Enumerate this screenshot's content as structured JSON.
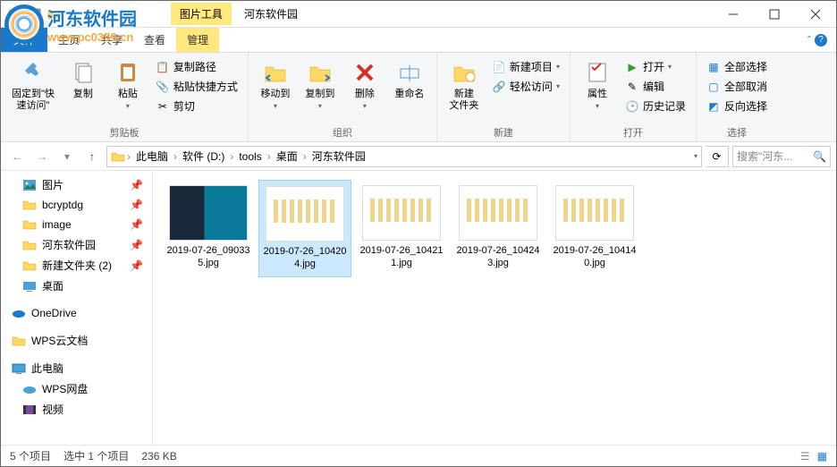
{
  "window": {
    "tools_tab": "图片工具",
    "title": "河东软件园",
    "file_tab": "文件",
    "tabs": [
      "主页",
      "共享",
      "查看"
    ],
    "manage_tab": "管理"
  },
  "watermark": {
    "title": "河东软件园",
    "url": "www.pc0359.cn"
  },
  "ribbon": {
    "clipboard": {
      "label": "剪贴板",
      "pin": "固定到\"快\n速访问\"",
      "copy": "复制",
      "paste": "粘贴",
      "copy_path": "复制路径",
      "paste_shortcut": "粘贴快捷方式",
      "cut": "剪切"
    },
    "organize": {
      "label": "组织",
      "move_to": "移动到",
      "copy_to": "复制到",
      "delete": "删除",
      "rename": "重命名"
    },
    "new": {
      "label": "新建",
      "new_folder": "新建\n文件夹",
      "new_item": "新建项目",
      "easy_access": "轻松访问"
    },
    "open": {
      "label": "打开",
      "properties": "属性",
      "open": "打开",
      "edit": "编辑",
      "history": "历史记录"
    },
    "select": {
      "label": "选择",
      "select_all": "全部选择",
      "select_none": "全部取消",
      "invert": "反向选择"
    }
  },
  "breadcrumbs": [
    "此电脑",
    "软件 (D:)",
    "tools",
    "桌面",
    "河东软件园"
  ],
  "search_placeholder": "搜索\"河东...",
  "sidebar": {
    "items": [
      {
        "label": "图片",
        "pinned": true,
        "icon": "pictures"
      },
      {
        "label": "bcryptdg",
        "pinned": true,
        "icon": "folder"
      },
      {
        "label": "image",
        "pinned": true,
        "icon": "folder"
      },
      {
        "label": "河东软件园",
        "pinned": true,
        "icon": "folder"
      },
      {
        "label": "新建文件夹 (2)",
        "pinned": true,
        "icon": "folder"
      },
      {
        "label": "桌面",
        "pinned": false,
        "icon": "desktop"
      }
    ],
    "onedrive": "OneDrive",
    "wps_doc": "WPS云文档",
    "this_pc": "此电脑",
    "wps_drive": "WPS网盘",
    "video": "视频"
  },
  "files": [
    {
      "name": "2019-07-26_090335.jpg",
      "variant": "dark",
      "selected": false
    },
    {
      "name": "2019-07-26_104204.jpg",
      "variant": "light",
      "selected": true
    },
    {
      "name": "2019-07-26_104211.jpg",
      "variant": "light",
      "selected": false
    },
    {
      "name": "2019-07-26_104243.jpg",
      "variant": "light",
      "selected": false
    },
    {
      "name": "2019-07-26_104140.jpg",
      "variant": "light",
      "selected": false
    }
  ],
  "status": {
    "count": "5 个项目",
    "selected": "选中 1 个项目",
    "size": "236 KB"
  }
}
